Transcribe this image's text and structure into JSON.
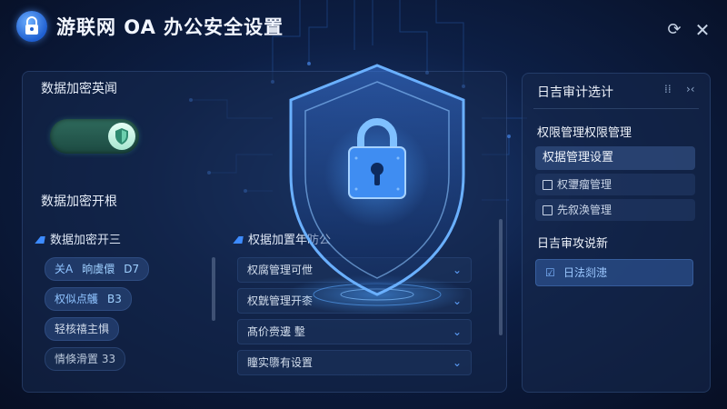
{
  "window": {
    "title": "游联网 OA 办公安全设置",
    "refresh_icon": "refresh-icon",
    "close_icon": "close-icon",
    "close_glyph": "✕",
    "refresh_glyph": "⟳"
  },
  "left_panel": {
    "title": "数据加密英闻",
    "toggle": {
      "state": "on",
      "icon": "shield-icon"
    },
    "subtitle": "数据加密开根",
    "section_a": {
      "heading": "数据加密开三",
      "chips": [
        {
          "key": "关A",
          "value": "晌虞儇",
          "extra": "D7"
        },
        {
          "key": "权似点鸌",
          "value": "B3"
        },
        {
          "text": "轻核禧主惧"
        },
        {
          "text": "情倏滑置 33"
        }
      ]
    },
    "section_b": {
      "heading": "权据加置年昉公",
      "rows": [
        {
          "label": "权腐管理可伳"
        },
        {
          "label": "权皝管理开桼"
        },
        {
          "label": "髙价赍遱 墼"
        },
        {
          "label": "瞳实隳有设置"
        }
      ],
      "chevron": "⌄"
    }
  },
  "right_panel": {
    "title": "日吉审计选计",
    "icons": [
      "collapse-icon",
      "expand-icon"
    ],
    "icon_glyphs": [
      "⁞⁞",
      "›‹"
    ],
    "heading1": "权限管理权限管理",
    "items": [
      {
        "label": "权据管理设置",
        "selected": true
      },
      {
        "label": "权瓕瘤管理",
        "checkbox": true
      },
      {
        "label": "先叙涣管理",
        "checkbox": true
      }
    ],
    "heading2": "日吉审攻说新",
    "action": {
      "label": "日法剡漶",
      "icon": "checkbox-checked-icon",
      "glyph": "☑"
    }
  },
  "colors": {
    "accent": "#3d8bff",
    "background": "#0d1f45",
    "toggle_on": "#2f6a5c"
  }
}
